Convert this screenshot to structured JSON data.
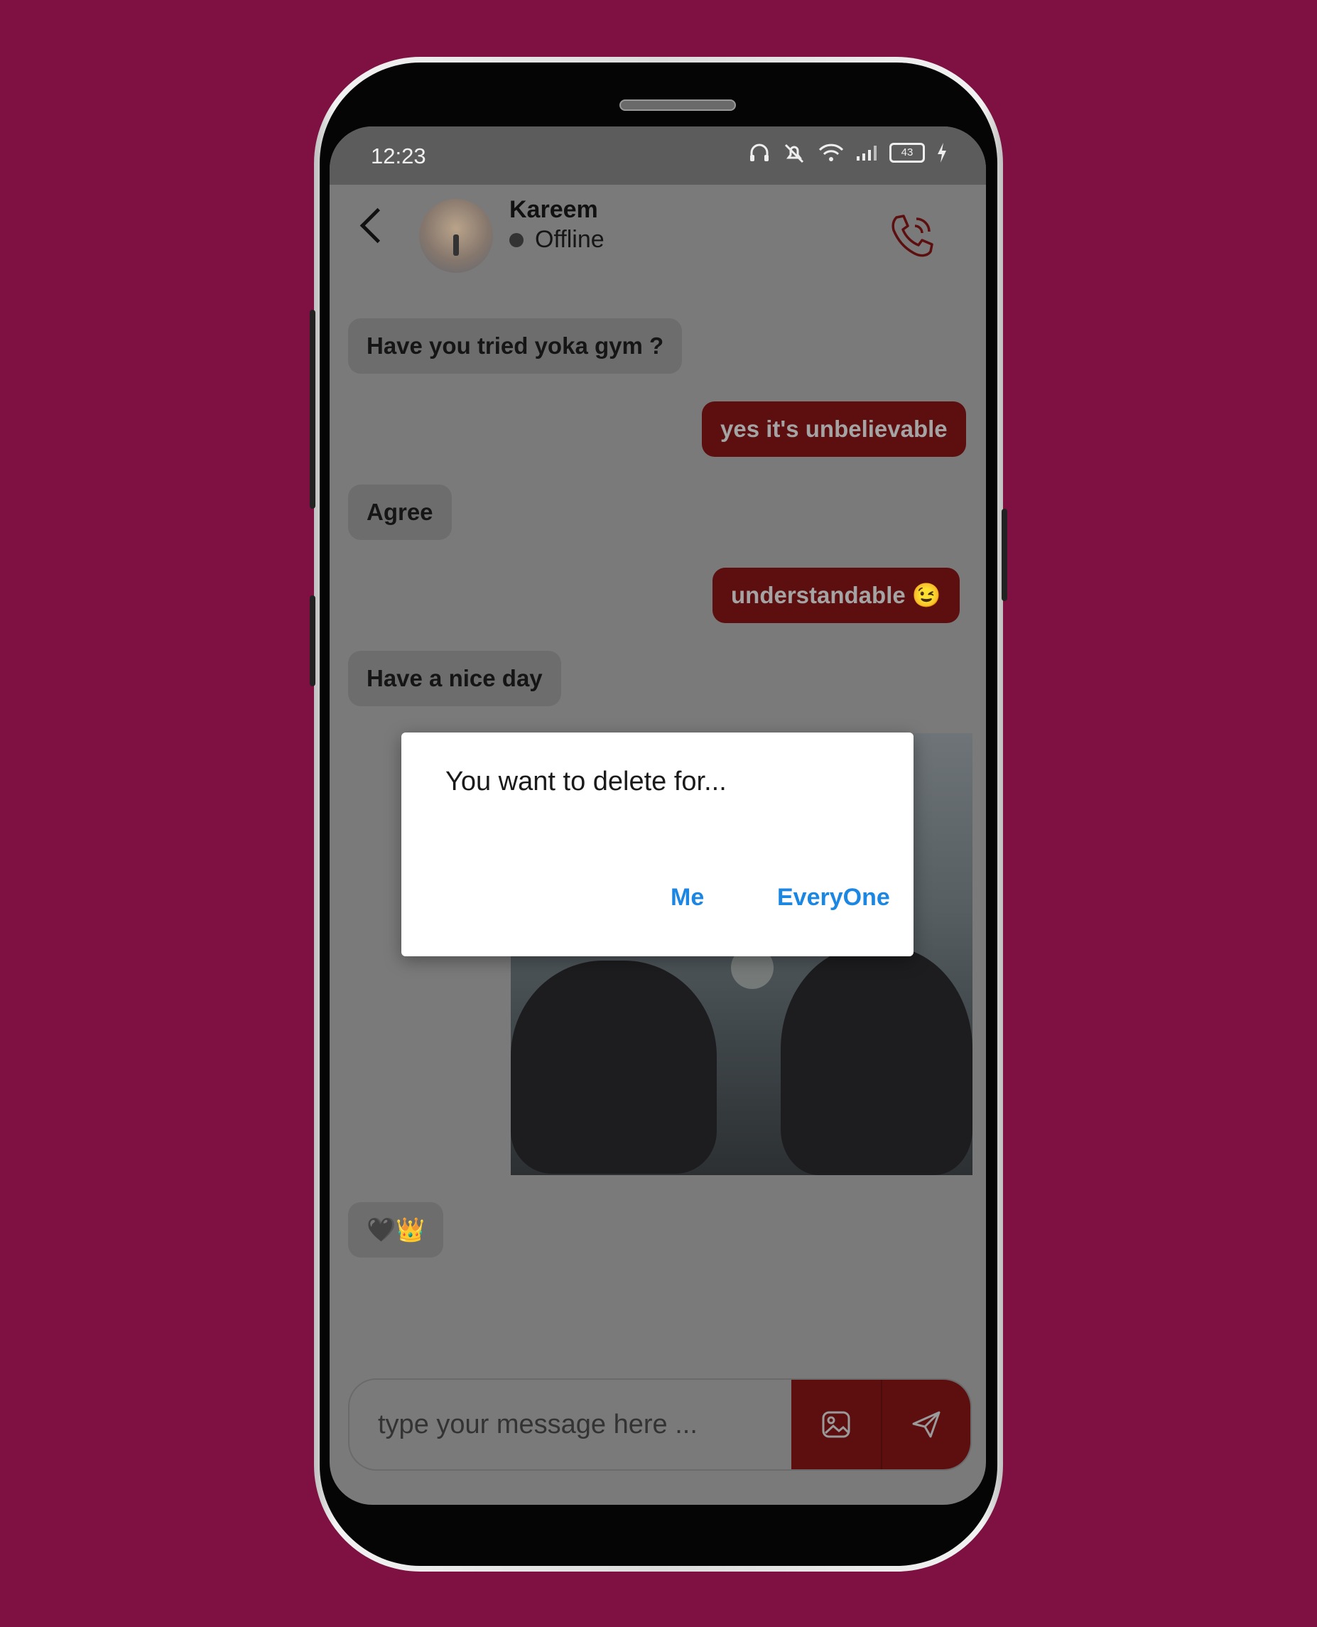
{
  "status_bar": {
    "time": "12:23",
    "battery_level": "43"
  },
  "header": {
    "contact_name": "Kareem",
    "presence": "Offline"
  },
  "messages": [
    {
      "direction": "incoming",
      "text": "Have you tried yoka gym ?"
    },
    {
      "direction": "outgoing",
      "text": "yes it's unbelievable"
    },
    {
      "direction": "incoming",
      "text": "Agree"
    },
    {
      "direction": "outgoing",
      "text": "understandable 😉"
    },
    {
      "direction": "incoming",
      "text": "Have a nice day"
    },
    {
      "direction": "incoming",
      "text": "🖤👑"
    }
  ],
  "input": {
    "placeholder": "type your message here ..."
  },
  "dialog": {
    "title": "You want to delete for...",
    "option_me": "Me",
    "option_everyone": "EveryOne"
  },
  "colors": {
    "background": "#7e1141",
    "outgoing_bubble": "#5d0f10",
    "dialog_button": "#1c86e3"
  }
}
